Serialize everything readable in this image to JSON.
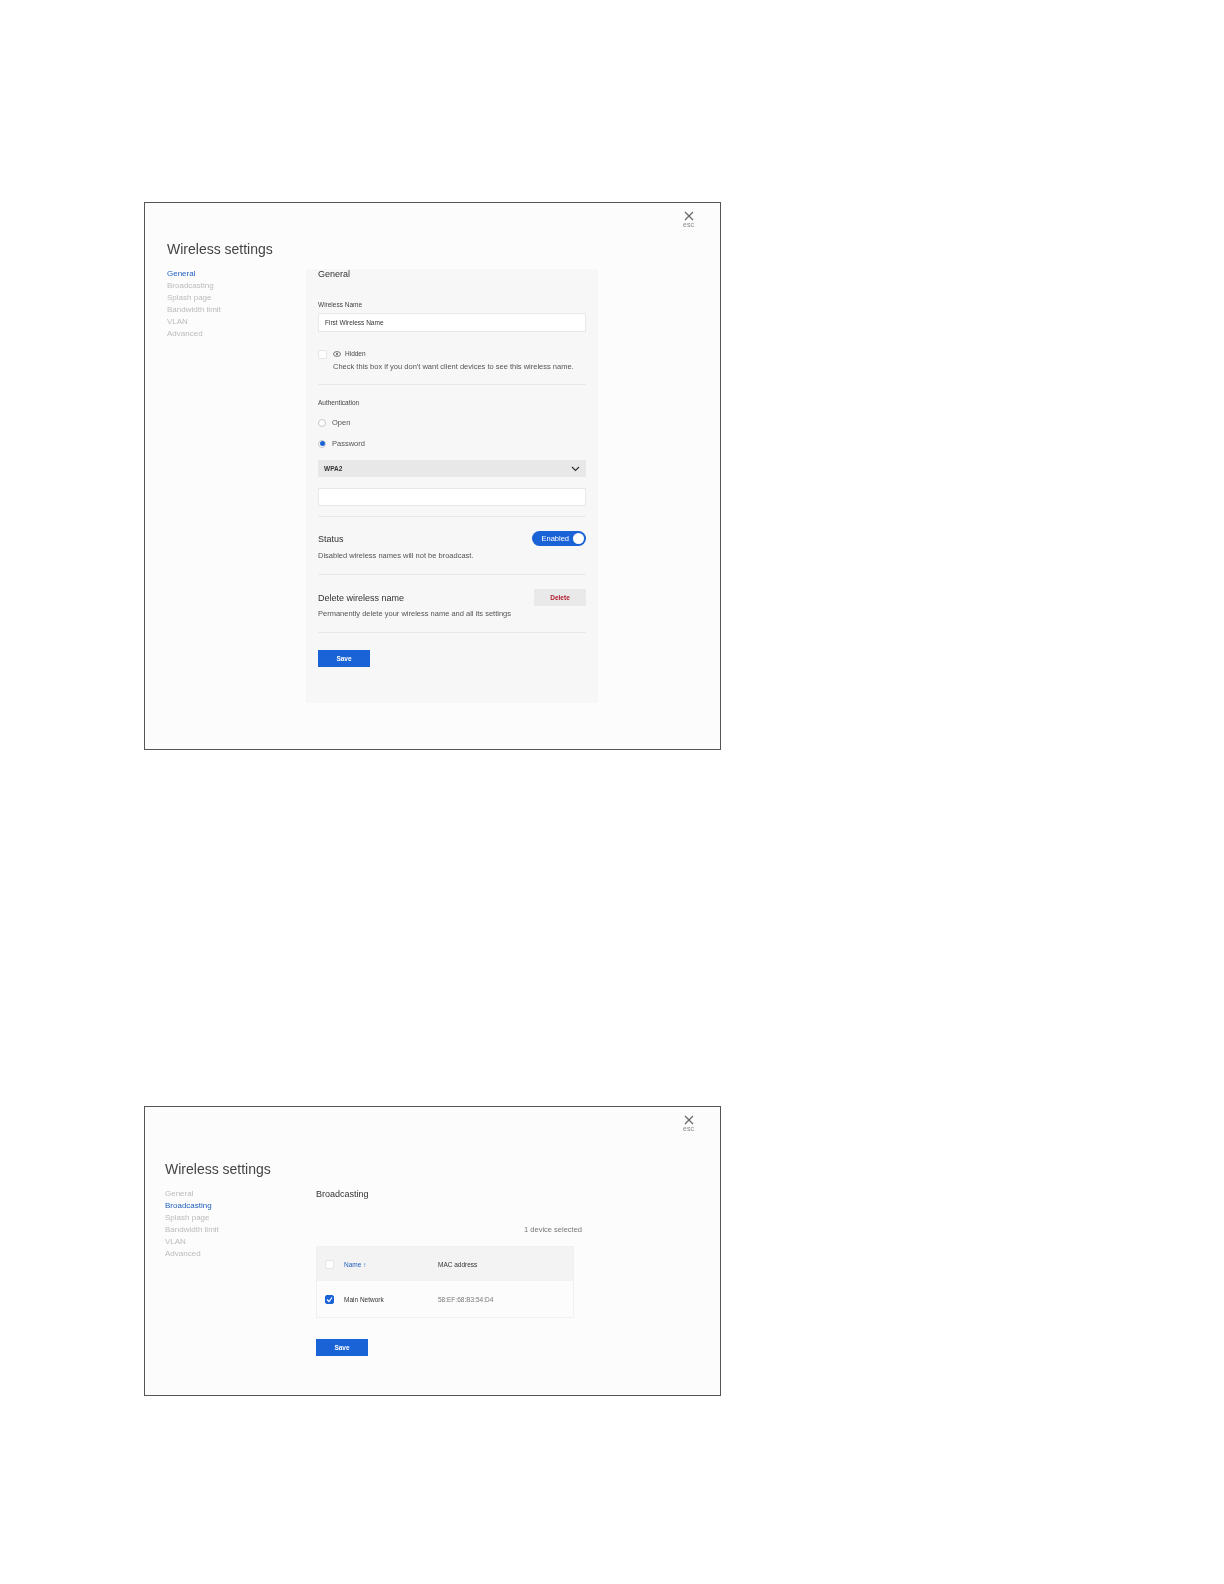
{
  "screens": [
    {
      "kind": "general",
      "close": "esc",
      "title": "Wireless settings",
      "nav": [
        {
          "label": "General",
          "selected": true
        },
        {
          "label": "Broadcasting",
          "selected": false
        },
        {
          "label": "Splash page",
          "selected": false
        },
        {
          "label": "Bandwidth limit",
          "selected": false
        },
        {
          "label": "VLAN",
          "selected": false
        },
        {
          "label": "Advanced",
          "selected": false
        }
      ],
      "heading": "General",
      "wireless_name": {
        "label": "Wireless Name",
        "value": "First Wireless Name"
      },
      "hidden": {
        "label": "Hidden",
        "checked": false,
        "hint": "Check this box if you don't want client devices to see this wireless name."
      },
      "authentication": {
        "label": "Authentication",
        "options": [
          {
            "label": "Open",
            "selected": false
          },
          {
            "label": "Password",
            "selected": true
          }
        ],
        "security": "WPA2"
      },
      "status": {
        "title": "Status",
        "toggle": "Enabled",
        "on": true,
        "hint": "Disabled wireless names will not be broadcast."
      },
      "delete": {
        "title": "Delete wireless name",
        "button": "Delete",
        "hint": "Permanently delete your wireless name and all its settings"
      },
      "save": "Save"
    },
    {
      "kind": "broadcasting",
      "close": "esc",
      "title": "Wireless settings",
      "nav": [
        {
          "label": "General",
          "selected": false
        },
        {
          "label": "Broadcasting",
          "selected": true
        },
        {
          "label": "Splash page",
          "selected": false
        },
        {
          "label": "Bandwidth limit",
          "selected": false
        },
        {
          "label": "VLAN",
          "selected": false
        },
        {
          "label": "Advanced",
          "selected": false
        }
      ],
      "heading": "Broadcasting",
      "count": "1 device selected",
      "table": {
        "columns": [
          "Name ↑",
          "MAC address"
        ],
        "all_checked": false,
        "rows": [
          {
            "name": "Main Network",
            "mac": "58:EF:68:B3:54:D4",
            "checked": true
          }
        ]
      },
      "save": "Save"
    }
  ]
}
